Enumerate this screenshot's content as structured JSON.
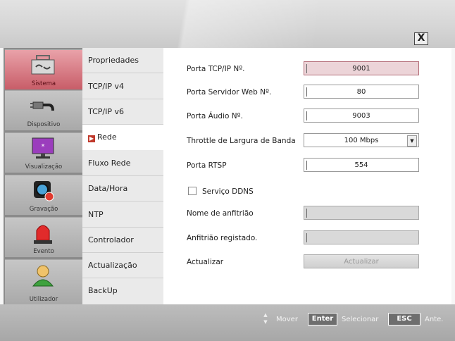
{
  "window": {
    "close_label": "X"
  },
  "sidebar": {
    "items": [
      {
        "label": "Sistema",
        "icon": "toolbox-icon",
        "active": true
      },
      {
        "label": "Dispositivo",
        "icon": "cable-icon"
      },
      {
        "label": "Visualização",
        "icon": "monitor-icon"
      },
      {
        "label": "Gravação",
        "icon": "camera-icon"
      },
      {
        "label": "Evento",
        "icon": "alarm-light-icon"
      },
      {
        "label": "Utilizador",
        "icon": "user-icon"
      }
    ]
  },
  "submenu": {
    "items": [
      {
        "label": "Propriedades"
      },
      {
        "label": "TCP/IP v4"
      },
      {
        "label": "TCP/IP v6"
      },
      {
        "label": "Rede",
        "active": true
      },
      {
        "label": "Fluxo Rede"
      },
      {
        "label": "Data/Hora"
      },
      {
        "label": "NTP"
      },
      {
        "label": "Controlador"
      },
      {
        "label": "Actualização"
      },
      {
        "label": "BackUp"
      }
    ]
  },
  "form": {
    "tcp_port": {
      "label": "Porta TCP/IP Nº.",
      "value": "9001"
    },
    "web_port": {
      "label": "Porta Servidor Web Nº.",
      "value": "80"
    },
    "audio_port": {
      "label": "Porta Áudio Nº.",
      "value": "9003"
    },
    "bandwidth": {
      "label": "Throttle de Largura de Banda",
      "value": "100 Mbps"
    },
    "rtsp_port": {
      "label": "Porta RTSP",
      "value": "554"
    },
    "ddns": {
      "label": "Serviço DDNS",
      "checked": false
    },
    "hostname": {
      "label": "Nome de anfitrião",
      "value": ""
    },
    "registered_host": {
      "label": "Anfitrião registado.",
      "value": ""
    },
    "update": {
      "label": "Actualizar",
      "button_label": "Actualizar"
    }
  },
  "statusbar": {
    "move_label": "Mover",
    "enter_key": "Enter",
    "select_label": "Selecionar",
    "esc_key": "ESC",
    "back_label": "Ante."
  },
  "colors": {
    "accent": "#c85d68",
    "focus_field": "#ecd4d8"
  }
}
